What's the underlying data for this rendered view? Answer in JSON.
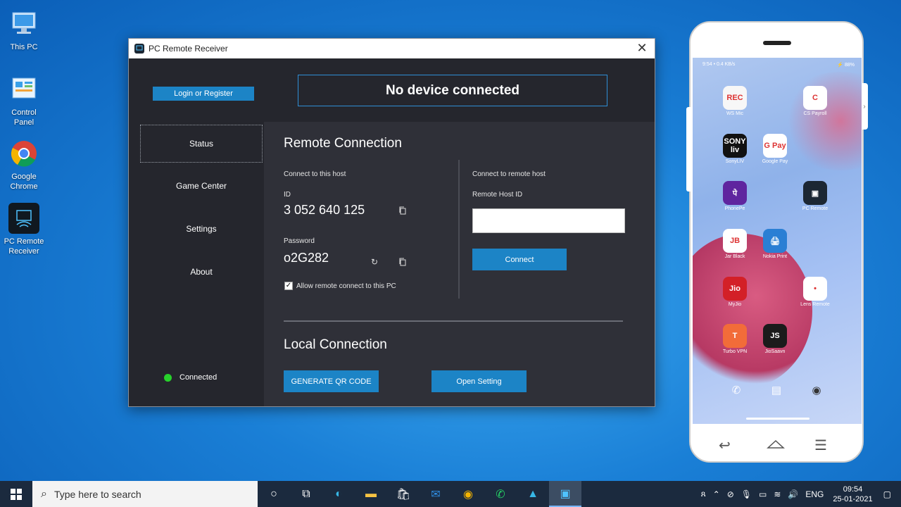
{
  "desktop": {
    "icons": [
      {
        "label_line1": "This PC",
        "label_line2": ""
      },
      {
        "label_line1": "Control",
        "label_line2": "Panel"
      },
      {
        "label_line1": "Google",
        "label_line2": "Chrome"
      },
      {
        "label_line1": "PC Remote",
        "label_line2": "Receiver"
      }
    ]
  },
  "window": {
    "title": "PC Remote Receiver",
    "close_glyph": "✕",
    "login_label": "Login or Register",
    "device_status": "No device connected",
    "sidebar": {
      "items": [
        {
          "label": "Status"
        },
        {
          "label": "Game Center"
        },
        {
          "label": "Settings"
        },
        {
          "label": "About"
        }
      ],
      "connection_label": "Connected",
      "connection_color": "#27d12b"
    },
    "remote": {
      "heading": "Remote Connection",
      "host_label": "Connect to this host",
      "id_label": "ID",
      "id_value": "3 052 640 125",
      "password_label": "Password",
      "password_value": "o2G282",
      "allow_label": "Allow remote connect to this PC",
      "allow_checked": "✓",
      "remote_label": "Connect to remote host",
      "remote_id_label": "Remote Host ID",
      "remote_id_value": "",
      "connect_label": "Connect"
    },
    "local": {
      "heading": "Local Connection",
      "qr_label": "GENERATE QR CODE",
      "setting_label": "Open Setting"
    }
  },
  "phone": {
    "apps": [
      {
        "label": "REC",
        "name": "WS Mic",
        "color": "#f7f7f7"
      },
      {
        "label": "C",
        "name": "CS Payroll",
        "color": "#ffffff"
      },
      {
        "label": "SONY liv",
        "name": "SonyLIV",
        "color": "#111111"
      },
      {
        "label": "G Pay",
        "name": "Google Pay",
        "color": "#ffffff"
      },
      {
        "label": "पे",
        "name": "PhonePe",
        "color": "#5f259f"
      },
      {
        "label": "▣",
        "name": "PC Remote",
        "color": "#1c2733"
      },
      {
        "label": "JB",
        "name": "Jar Black",
        "color": "#ffffff"
      },
      {
        "label": "🖨",
        "name": "Nokia Print",
        "color": "#2a7fd4"
      },
      {
        "label": "Jio",
        "name": "MyJio",
        "color": "#d32027"
      },
      {
        "label": "•",
        "name": "Lens Remote",
        "color": "#ffffff"
      },
      {
        "label": "T",
        "name": "Turbo VPN",
        "color": "#f26c39"
      },
      {
        "label": "JS",
        "name": "JioSaavn",
        "color": "#1b1b1b"
      }
    ],
    "dock": [
      {
        "glyph": "✆",
        "color": "#2ebd59"
      },
      {
        "glyph": "▤",
        "color": "#f5b83d"
      },
      {
        "glyph": "◉",
        "color": "#ffffff"
      }
    ],
    "status_left": "9:54 • 0.4 KB/s",
    "status_right": "⚡ 88%"
  },
  "taskbar": {
    "search_placeholder": "Type here to search",
    "lang": "ENG",
    "time": "09:54",
    "date": "25-01-2021"
  }
}
